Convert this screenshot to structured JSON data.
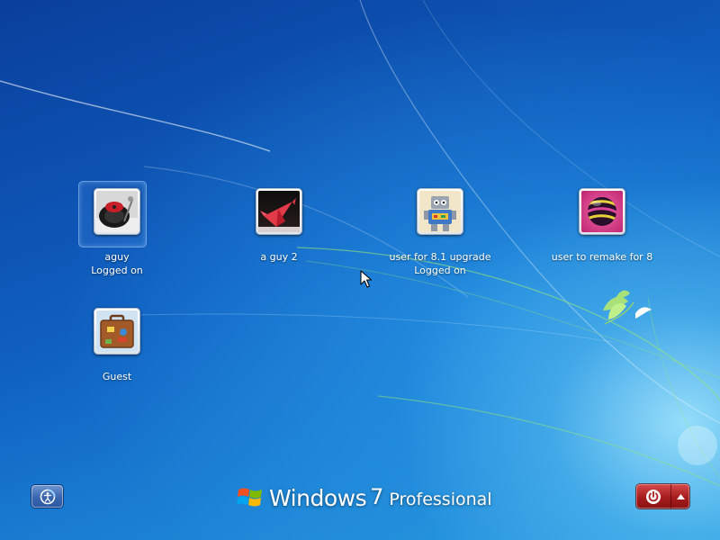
{
  "users": [
    {
      "name": "aguy",
      "status": "Logged on",
      "picture": "turntable-record-picture",
      "selected": true
    },
    {
      "name": "a guy 2",
      "status": "",
      "picture": "paper-crane-picture",
      "selected": false
    },
    {
      "name": "user for 8.1 upgrade",
      "status": "Logged on",
      "picture": "toy-robot-picture",
      "selected": false
    },
    {
      "name": "user to remake for 8",
      "status": "",
      "picture": "striped-ball-picture",
      "selected": false
    },
    {
      "name": "Guest",
      "status": "",
      "picture": "suitcase-picture",
      "selected": false
    }
  ],
  "footer": {
    "ease_of_access_icon": "ease-of-access-icon",
    "power_icon": "power-icon",
    "power_menu_icon": "triangle-up-icon"
  },
  "branding": {
    "word": "Windows",
    "version": "7",
    "edition": "Professional"
  },
  "colors": {
    "power_button": "#a61d1d",
    "ease_button": "#3a66b0",
    "wallpaper_top": "#0a3f9c",
    "wallpaper_glow": "#aaebff"
  }
}
